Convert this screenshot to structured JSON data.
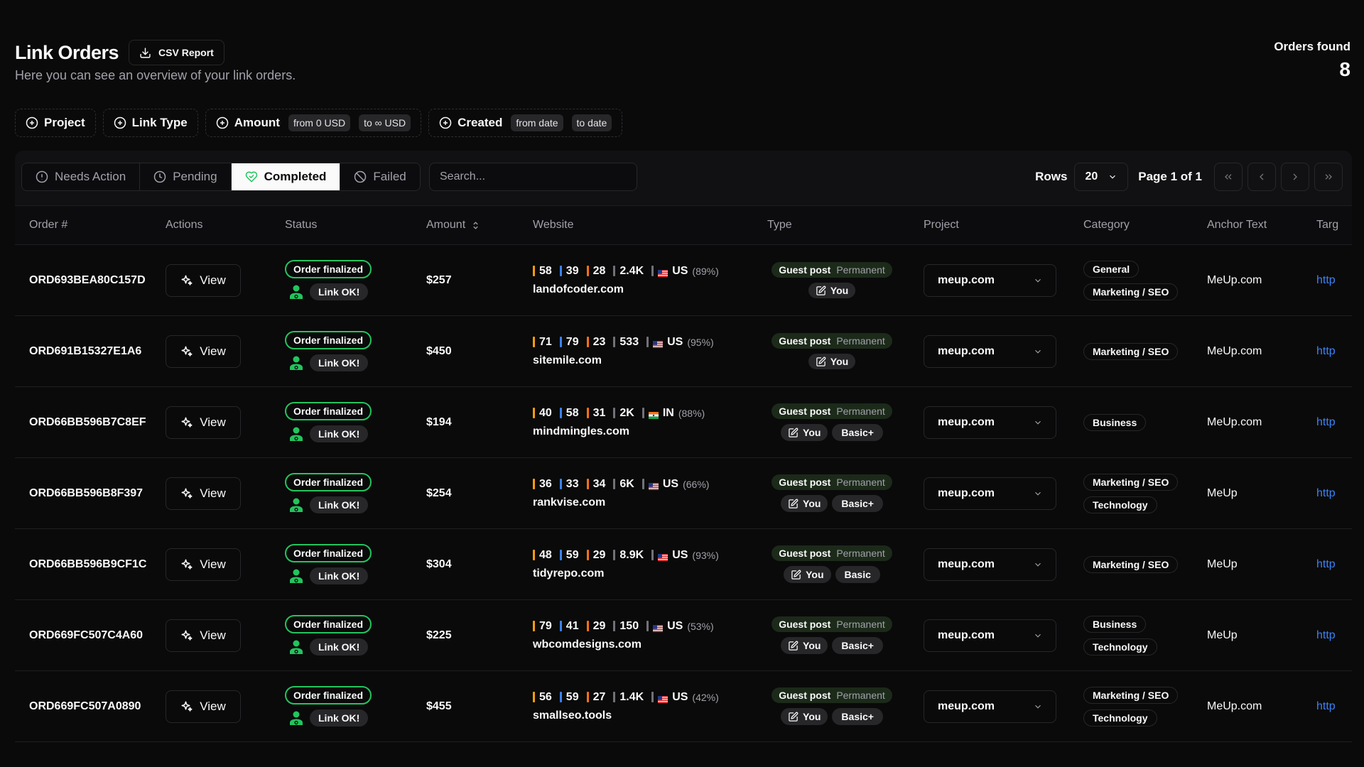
{
  "header": {
    "title": "Link Orders",
    "csv_label": "CSV Report",
    "subtitle": "Here you can see an overview of your link orders.",
    "orders_found_label": "Orders found",
    "orders_found_count": "8"
  },
  "filters": {
    "project": "Project",
    "link_type": "Link Type",
    "amount": "Amount",
    "amount_from": "from 0 USD",
    "amount_to": "to ∞ USD",
    "created": "Created",
    "created_from": "from date",
    "created_to": "to date"
  },
  "tabs": {
    "needs_action": "Needs Action",
    "pending": "Pending",
    "completed": "Completed",
    "failed": "Failed",
    "active": "Completed"
  },
  "search": {
    "placeholder": "Search..."
  },
  "pager": {
    "rows_label": "Rows",
    "rows_value": "20",
    "page_info": "Page 1 of 1"
  },
  "columns": {
    "order": "Order #",
    "actions": "Actions",
    "status": "Status",
    "amount": "Amount",
    "website": "Website",
    "type": "Type",
    "project": "Project",
    "category": "Category",
    "anchor": "Anchor Text",
    "target": "Targ"
  },
  "colors": {
    "metric1": "#f59e0b",
    "metric2": "#3b82f6",
    "metric3": "#f97316",
    "metric4": "#71717a",
    "status_green": "#22c55e",
    "link": "#3b82f6"
  },
  "rows": [
    {
      "order": "ORD693BEA80C157D",
      "view": "View",
      "status": "Order finalized",
      "link_status": "Link OK!",
      "amount": "$257",
      "m1": "58",
      "m2": "39",
      "m3": "28",
      "m4": "2.4K",
      "country": "US",
      "pct": "(89%)",
      "flag": "us",
      "domain": "landofcoder.com",
      "type": "Guest post",
      "duration": "Permanent",
      "you": "You",
      "tier": "",
      "project": "meup.com",
      "categories": [
        "General",
        "Marketing / SEO"
      ],
      "anchor": "MeUp.com",
      "target": "http"
    },
    {
      "order": "ORD691B15327E1A6",
      "view": "View",
      "status": "Order finalized",
      "link_status": "Link OK!",
      "amount": "$450",
      "m1": "71",
      "m2": "79",
      "m3": "23",
      "m4": "533",
      "country": "US",
      "pct": "(95%)",
      "flag": "us",
      "domain": "sitemile.com",
      "type": "Guest post",
      "duration": "Permanent",
      "you": "You",
      "tier": "",
      "project": "meup.com",
      "categories": [
        "Marketing / SEO"
      ],
      "anchor": "MeUp.com",
      "target": "http"
    },
    {
      "order": "ORD66BB596B7C8EF",
      "view": "View",
      "status": "Order finalized",
      "link_status": "Link OK!",
      "amount": "$194",
      "m1": "40",
      "m2": "58",
      "m3": "31",
      "m4": "2K",
      "country": "IN",
      "pct": "(88%)",
      "flag": "in",
      "domain": "mindmingles.com",
      "type": "Guest post",
      "duration": "Permanent",
      "you": "You",
      "tier": "Basic+",
      "project": "meup.com",
      "categories": [
        "Business"
      ],
      "anchor": "MeUp.com",
      "target": "http"
    },
    {
      "order": "ORD66BB596B8F397",
      "view": "View",
      "status": "Order finalized",
      "link_status": "Link OK!",
      "amount": "$254",
      "m1": "36",
      "m2": "33",
      "m3": "34",
      "m4": "6K",
      "country": "US",
      "pct": "(66%)",
      "flag": "us",
      "domain": "rankvise.com",
      "type": "Guest post",
      "duration": "Permanent",
      "you": "You",
      "tier": "Basic+",
      "project": "meup.com",
      "categories": [
        "Marketing / SEO",
        "Technology"
      ],
      "anchor": "MeUp",
      "target": "http"
    },
    {
      "order": "ORD66BB596B9CF1C",
      "view": "View",
      "status": "Order finalized",
      "link_status": "Link OK!",
      "amount": "$304",
      "m1": "48",
      "m2": "59",
      "m3": "29",
      "m4": "8.9K",
      "country": "US",
      "pct": "(93%)",
      "flag": "us",
      "domain": "tidyrepo.com",
      "type": "Guest post",
      "duration": "Permanent",
      "you": "You",
      "tier": "Basic",
      "project": "meup.com",
      "categories": [
        "Marketing / SEO"
      ],
      "anchor": "MeUp",
      "target": "http"
    },
    {
      "order": "ORD669FC507C4A60",
      "view": "View",
      "status": "Order finalized",
      "link_status": "Link OK!",
      "amount": "$225",
      "m1": "79",
      "m2": "41",
      "m3": "29",
      "m4": "150",
      "country": "US",
      "pct": "(53%)",
      "flag": "us",
      "domain": "wbcomdesigns.com",
      "type": "Guest post",
      "duration": "Permanent",
      "you": "You",
      "tier": "Basic+",
      "project": "meup.com",
      "categories": [
        "Business",
        "Technology"
      ],
      "anchor": "MeUp",
      "target": "http"
    },
    {
      "order": "ORD669FC507A0890",
      "view": "View",
      "status": "Order finalized",
      "link_status": "Link OK!",
      "amount": "$455",
      "m1": "56",
      "m2": "59",
      "m3": "27",
      "m4": "1.4K",
      "country": "US",
      "pct": "(42%)",
      "flag": "us",
      "domain": "smallseo.tools",
      "type": "Guest post",
      "duration": "Permanent",
      "you": "You",
      "tier": "Basic+",
      "project": "meup.com",
      "categories": [
        "Marketing / SEO",
        "Technology"
      ],
      "anchor": "MeUp.com",
      "target": "http"
    }
  ]
}
